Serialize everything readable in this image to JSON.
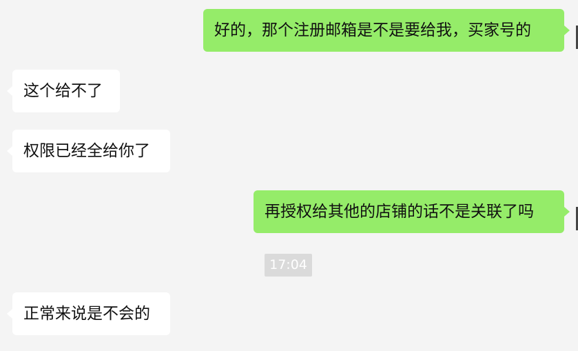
{
  "messages": [
    {
      "direction": "outgoing",
      "text": "好的，那个注册邮箱是不是要给我，买家号的"
    },
    {
      "direction": "incoming",
      "text": "这个给不了"
    },
    {
      "direction": "incoming",
      "text": "权限已经全给你了"
    },
    {
      "direction": "outgoing",
      "text": "再授权给其他的店铺的话不是关联了吗"
    },
    {
      "direction": "incoming",
      "text": "正常来说是不会的"
    }
  ],
  "timestamp": "17:04",
  "colors": {
    "background": "#f4f4f4",
    "incoming_bubble": "#ffffff",
    "outgoing_bubble": "#95ec69",
    "timestamp_bg": "#dadada"
  }
}
